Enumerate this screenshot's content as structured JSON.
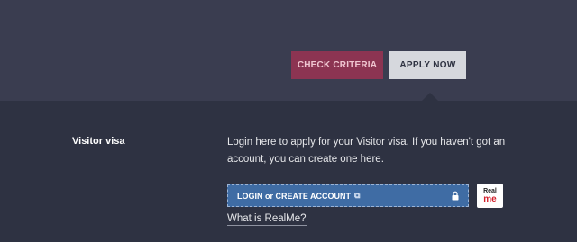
{
  "header": {
    "check_criteria_label": "CHECK CRITERIA",
    "apply_now_label": "APPLY NOW"
  },
  "section": {
    "title": "Visitor visa",
    "description": "Login here to apply for your Visitor visa. If you haven't got an account, you can create one here.",
    "login_button_label": "LOGIN or CREATE ACCOUNT",
    "realme_logo_line1": "Real",
    "realme_logo_line2": "me",
    "what_is_link": "What is RealMe?"
  },
  "icons": {
    "external_link": "external-link-icon",
    "lock": "lock-icon"
  },
  "colors": {
    "top_bg": "#3a3d50",
    "bottom_bg": "#2e3242",
    "check_criteria_bg": "#8c3452",
    "apply_now_bg": "#d6d8dd",
    "login_bg": "#3f6ca4",
    "realme_red": "#d21f2b"
  }
}
